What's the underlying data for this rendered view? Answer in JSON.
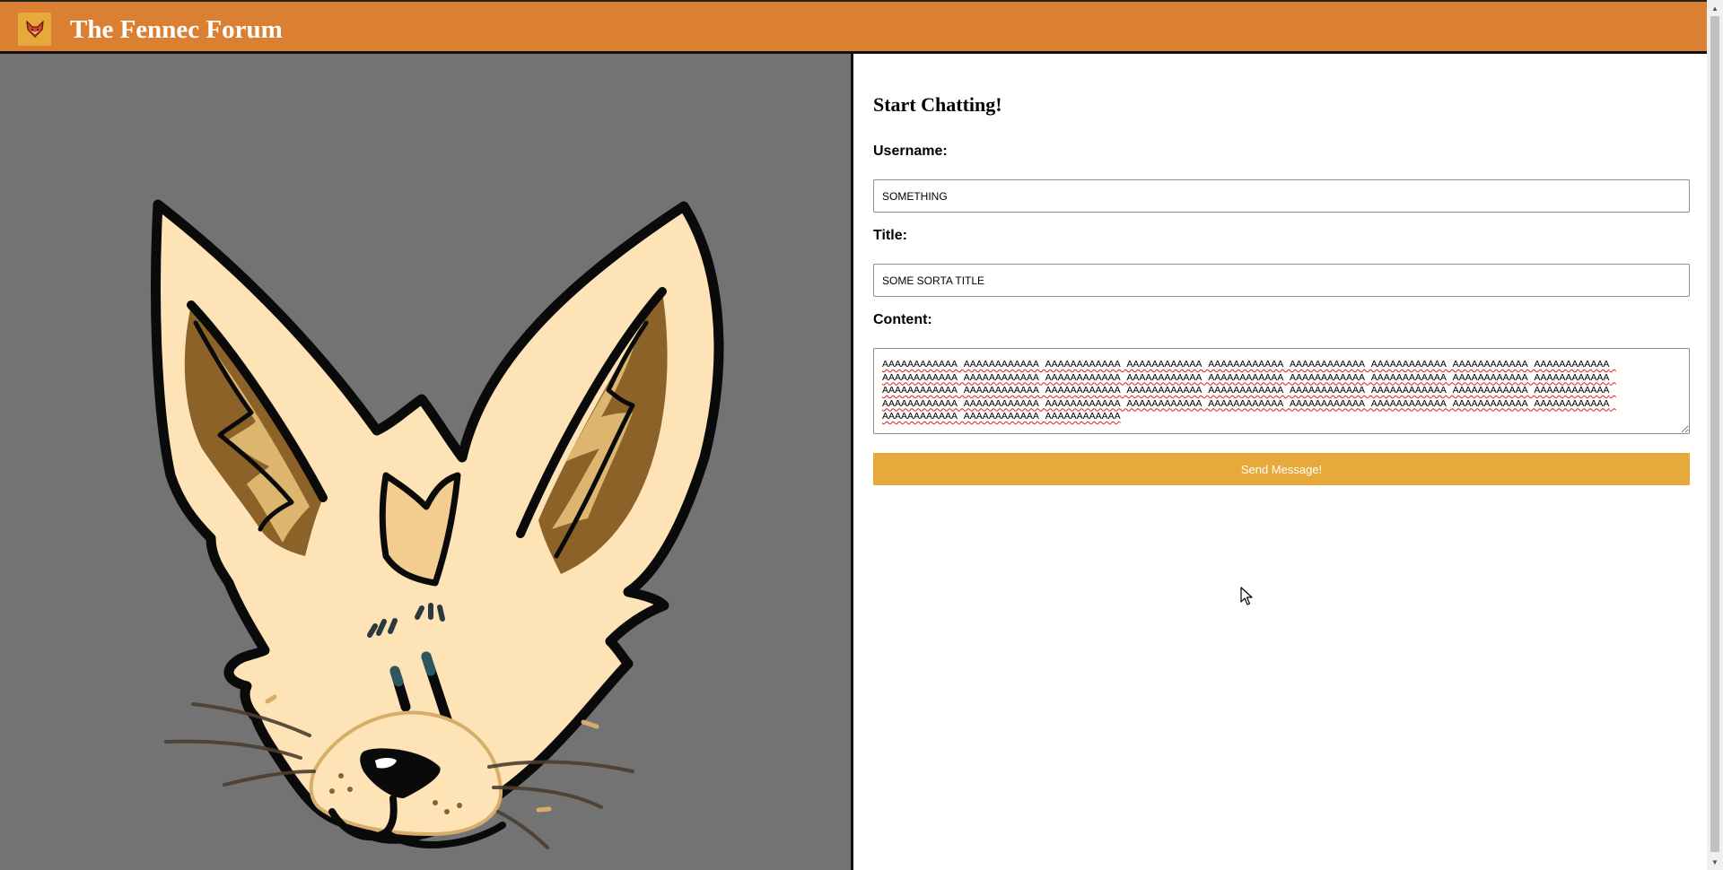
{
  "header": {
    "logo_icon": "fox-icon",
    "title": "The Fennec Forum",
    "background_color": "#db7f33"
  },
  "art": {
    "image_icon": "fennec-fox-icon",
    "background_color": "#737373"
  },
  "form": {
    "heading": "Start Chatting!",
    "username_label": "Username:",
    "username_value": "SOMETHING",
    "title_label": "Title:",
    "title_value": "SOME SORTA TITLE",
    "content_label": "Content:",
    "content_value": "AAAAAAAAAAAA AAAAAAAAAAAA AAAAAAAAAAAA AAAAAAAAAAAA AAAAAAAAAAAA AAAAAAAAAAAA AAAAAAAAAAAA AAAAAAAAAAAA AAAAAAAAAAAA AAAAAAAAAAAA AAAAAAAAAAAA AAAAAAAAAAAA AAAAAAAAAAAA AAAAAAAAAAAA AAAAAAAAAAAA AAAAAAAAAAAA AAAAAAAAAAAA AAAAAAAAAAAA AAAAAAAAAAAA AAAAAAAAAAAA AAAAAAAAAAAA AAAAAAAAAAAA AAAAAAAAAAAA AAAAAAAAAAAA AAAAAAAAAAAA AAAAAAAAAAAA AAAAAAAAAAAA AAAAAAAAAAAA AAAAAAAAAAAA AAAAAAAAAAAA AAAAAAAAAAAA AAAAAAAAAAAA AAAAAAAAAAAA AAAAAAAAAAAA AAAAAAAAAAAA AAAAAAAAAAAA AAAAAAAAAAAA AAAAAAAAAAAA AAAAAAAAAAAA",
    "send_label": "Send Message!",
    "accent_color": "#e6a93a"
  }
}
